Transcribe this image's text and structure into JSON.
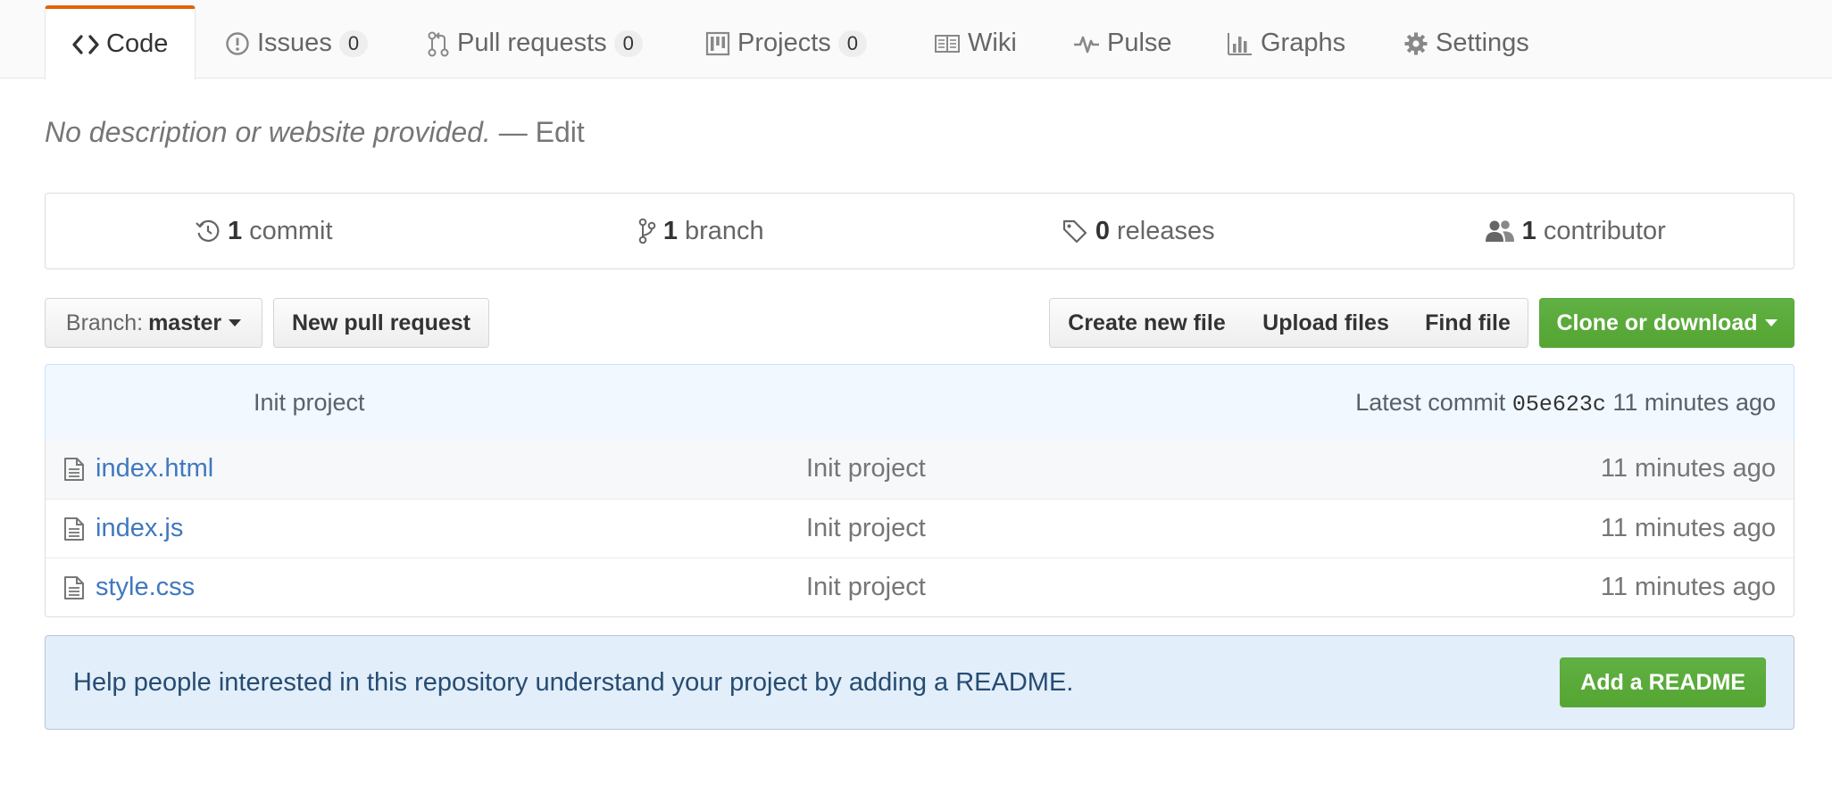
{
  "tabs": [
    {
      "label": "Code",
      "icon": "code-icon",
      "selected": true
    },
    {
      "label": "Issues",
      "icon": "issue-opened-icon",
      "count": "0"
    },
    {
      "label": "Pull requests",
      "icon": "git-pull-request-icon",
      "count": "0"
    },
    {
      "label": "Projects",
      "icon": "project-icon",
      "count": "0"
    },
    {
      "label": "Wiki",
      "icon": "book-icon"
    },
    {
      "label": "Pulse",
      "icon": "pulse-icon"
    },
    {
      "label": "Graphs",
      "icon": "graph-icon"
    },
    {
      "label": "Settings",
      "icon": "gear-icon"
    }
  ],
  "description": {
    "text": "No description or website provided.",
    "separator": "—",
    "edit_label": "Edit"
  },
  "summary": {
    "commits": {
      "count": "1",
      "label": "commit"
    },
    "branches": {
      "count": "1",
      "label": "branch"
    },
    "releases": {
      "count": "0",
      "label": "releases"
    },
    "contributors": {
      "count": "1",
      "label": "contributor"
    }
  },
  "toolbar": {
    "branch_prefix": "Branch:",
    "branch_name": "master",
    "new_pr_label": "New pull request",
    "create_file_label": "Create new file",
    "upload_label": "Upload files",
    "find_label": "Find file",
    "clone_label": "Clone or download"
  },
  "commit_bar": {
    "message": "Init project",
    "latest_label": "Latest commit",
    "sha": "05e623c",
    "age": "11 minutes ago"
  },
  "files": [
    {
      "name": "index.html",
      "message": "Init project",
      "age": "11 minutes ago"
    },
    {
      "name": "index.js",
      "message": "Init project",
      "age": "11 minutes ago"
    },
    {
      "name": "style.css",
      "message": "Init project",
      "age": "11 minutes ago"
    }
  ],
  "readme_prompt": {
    "text": "Help people interested in this repository understand your project by adding a README.",
    "button_label": "Add a README"
  },
  "colors": {
    "tab_accent": "#e36209",
    "link": "#4078c0",
    "green_button": "#5ca941",
    "commit_bar_bg": "#f1f8ff",
    "readme_bg": "#e2eef9"
  }
}
